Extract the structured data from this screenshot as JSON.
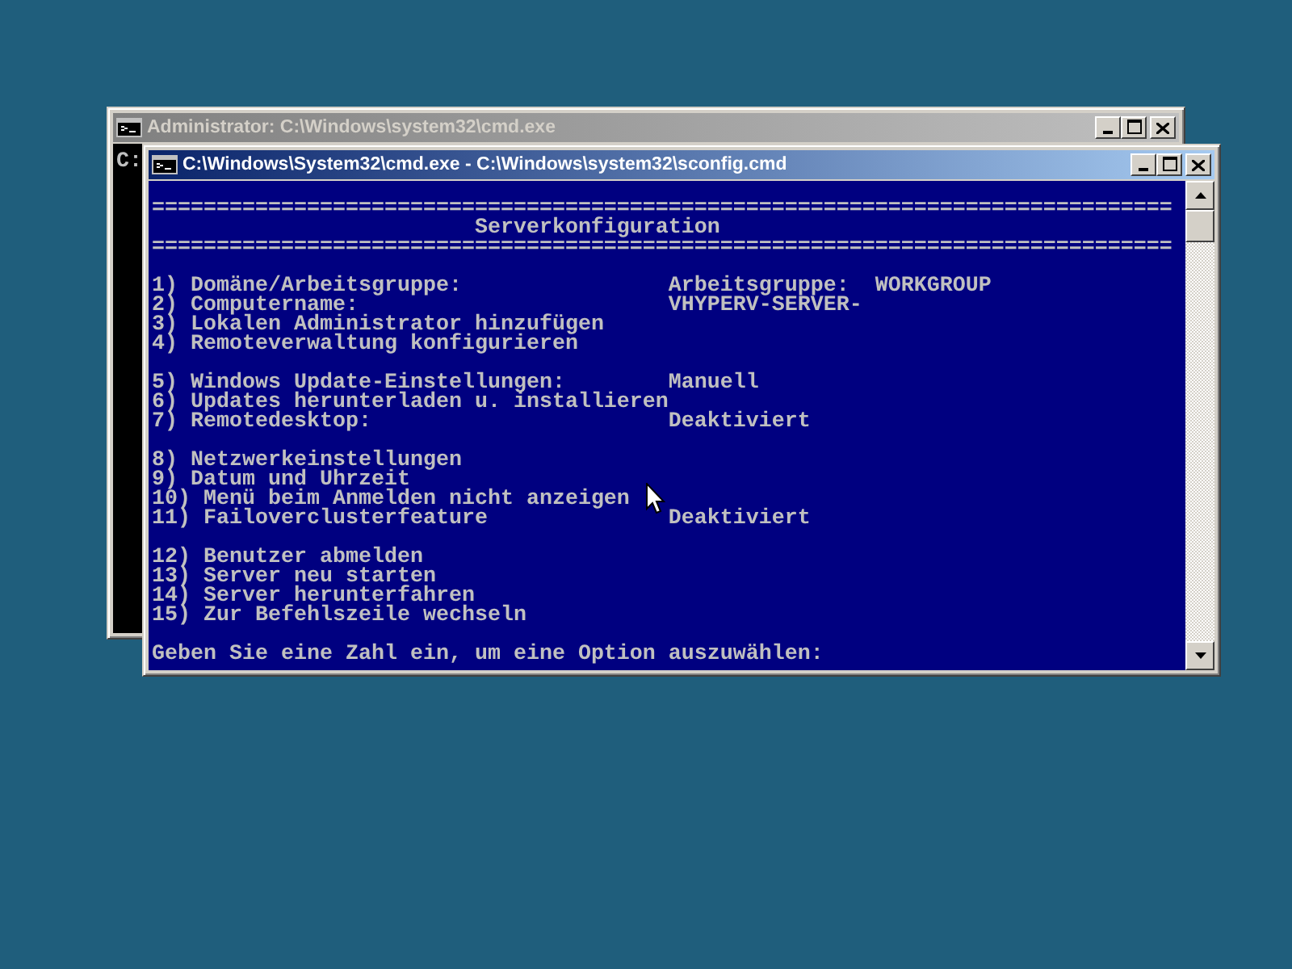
{
  "background_window": {
    "title": "Administrator: C:\\Windows\\system32\\cmd.exe",
    "active": false,
    "console_lines": [
      "C:"
    ]
  },
  "window": {
    "title": "C:\\Windows\\System32\\cmd.exe - C:\\Windows\\system32\\sconfig.cmd",
    "active": true,
    "console": [
      {
        "kind": "blank"
      },
      {
        "kind": "rule",
        "text": "==============================================================================="
      },
      {
        "kind": "title",
        "text": "Serverkonfiguration"
      },
      {
        "kind": "rule",
        "text": "==============================================================================="
      },
      {
        "kind": "blank"
      },
      {
        "kind": "item",
        "label": "1) Domäne/Arbeitsgruppe:",
        "value": "Arbeitsgruppe:  WORKGROUP"
      },
      {
        "kind": "item",
        "label": "2) Computername:",
        "value": "VHYPERV-SERVER-"
      },
      {
        "kind": "item",
        "label": "3) Lokalen Administrator hinzufügen"
      },
      {
        "kind": "item",
        "label": "4) Remoteverwaltung konfigurieren"
      },
      {
        "kind": "blank"
      },
      {
        "kind": "item",
        "label": "5) Windows Update-Einstellungen:",
        "value": "Manuell"
      },
      {
        "kind": "item",
        "label": "6) Updates herunterladen u. installieren"
      },
      {
        "kind": "item",
        "label": "7) Remotedesktop:",
        "value": "Deaktiviert"
      },
      {
        "kind": "blank"
      },
      {
        "kind": "item",
        "label": "8) Netzwerkeinstellungen"
      },
      {
        "kind": "item",
        "label": "9) Datum und Uhrzeit"
      },
      {
        "kind": "item",
        "label": "10) Menü beim Anmelden nicht anzeigen"
      },
      {
        "kind": "item",
        "label": "11) Failoverclusterfeature",
        "value": "Deaktiviert"
      },
      {
        "kind": "blank"
      },
      {
        "kind": "item",
        "label": "12) Benutzer abmelden"
      },
      {
        "kind": "item",
        "label": "13) Server neu starten"
      },
      {
        "kind": "item",
        "label": "14) Server herunterfahren"
      },
      {
        "kind": "item",
        "label": "15) Zur Befehlszeile wechseln"
      },
      {
        "kind": "blank"
      },
      {
        "kind": "prompt",
        "text": "Geben Sie eine Zahl ein, um eine Option auszuwählen:"
      }
    ]
  }
}
